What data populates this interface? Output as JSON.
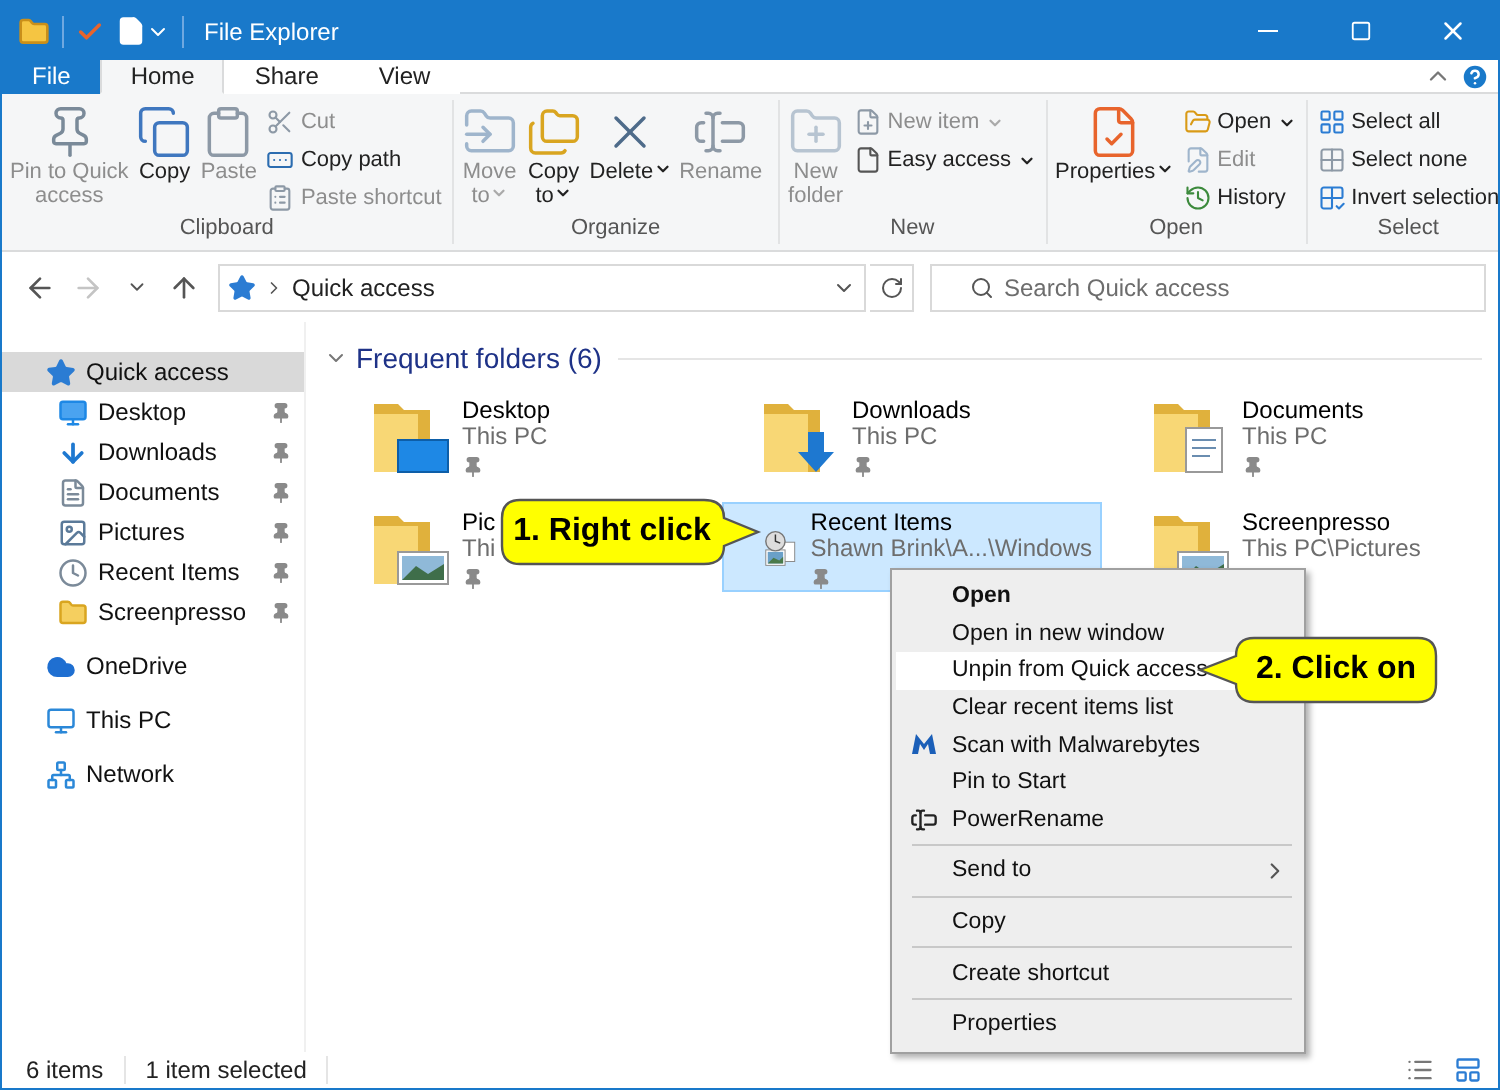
{
  "title_bar": {
    "title": "File Explorer"
  },
  "ribbon_tabs": [
    {
      "label": "File",
      "kind": "file",
      "selected": false
    },
    {
      "label": "Home",
      "kind": "tab",
      "selected": true
    },
    {
      "label": "Share",
      "kind": "tab",
      "selected": false
    },
    {
      "label": "View",
      "kind": "tab",
      "selected": false
    }
  ],
  "ribbon_groups": [
    {
      "label": "Clipboard",
      "buttons": [
        {
          "kind": "large",
          "label": "Pin to Quick\naccess",
          "disabled": true,
          "dropdown": false
        },
        {
          "kind": "large",
          "label": "Copy",
          "disabled": false,
          "dropdown": false
        },
        {
          "kind": "large",
          "label": "Paste",
          "disabled": true,
          "dropdown": false
        },
        {
          "kind": "small",
          "label": "Cut",
          "disabled": true,
          "dropdown": false
        },
        {
          "kind": "small",
          "label": "Copy path",
          "disabled": false,
          "dropdown": false
        },
        {
          "kind": "small",
          "label": "Paste shortcut",
          "disabled": true,
          "dropdown": false
        }
      ]
    },
    {
      "label": "Organize",
      "buttons": [
        {
          "kind": "large",
          "label": "Move\nto",
          "disabled": true,
          "dropdown": true
        },
        {
          "kind": "large",
          "label": "Copy\nto",
          "disabled": false,
          "dropdown": true
        },
        {
          "kind": "large",
          "label": "Delete",
          "disabled": false,
          "dropdown": true
        },
        {
          "kind": "large",
          "label": "Rename",
          "disabled": true,
          "dropdown": false
        }
      ]
    },
    {
      "label": "New",
      "buttons": [
        {
          "kind": "large",
          "label": "New\nfolder",
          "disabled": true,
          "dropdown": false
        },
        {
          "kind": "small",
          "label": "New item",
          "disabled": true,
          "dropdown": true
        },
        {
          "kind": "small",
          "label": "Easy access",
          "disabled": false,
          "dropdown": true
        }
      ]
    },
    {
      "label": "Open",
      "buttons": [
        {
          "kind": "large",
          "label": "Properties",
          "disabled": false,
          "dropdown": true
        },
        {
          "kind": "small",
          "label": "Open",
          "disabled": false,
          "dropdown": true
        },
        {
          "kind": "small",
          "label": "Edit",
          "disabled": true,
          "dropdown": false
        },
        {
          "kind": "small",
          "label": "History",
          "disabled": false,
          "dropdown": false
        }
      ]
    },
    {
      "label": "Select",
      "buttons": [
        {
          "kind": "small",
          "label": "Select all",
          "disabled": false,
          "dropdown": false
        },
        {
          "kind": "small",
          "label": "Select none",
          "disabled": false,
          "dropdown": false
        },
        {
          "kind": "small",
          "label": "Invert selection",
          "disabled": false,
          "dropdown": false
        }
      ]
    }
  ],
  "nav_buttons": [
    {
      "disabled": false
    },
    {
      "disabled": true
    },
    {
      "disabled": false
    },
    {
      "disabled": false
    }
  ],
  "address": {
    "location": "Quick access"
  },
  "search": {
    "placeholder": "Search Quick access"
  },
  "sidebar": {
    "items": [
      {
        "label": "Quick access",
        "selected": true,
        "children": [
          {
            "label": "Desktop",
            "pinned": true,
            "selected": false
          },
          {
            "label": "Downloads",
            "pinned": true,
            "selected": false
          },
          {
            "label": "Documents",
            "pinned": true,
            "selected": false
          },
          {
            "label": "Pictures",
            "pinned": true,
            "selected": false
          },
          {
            "label": "Recent Items",
            "pinned": true,
            "selected": false
          },
          {
            "label": "Screenpresso",
            "pinned": true,
            "selected": false
          }
        ]
      },
      {
        "label": "OneDrive",
        "selected": false
      },
      {
        "label": "This PC",
        "selected": false
      },
      {
        "label": "Network",
        "selected": false
      }
    ]
  },
  "section": {
    "title": "Frequent folders (6)",
    "expanded": true,
    "tiles": [
      {
        "name": "Desktop",
        "location": "This PC",
        "pinned": true,
        "selected": false
      },
      {
        "name": "Downloads",
        "location": "This PC",
        "pinned": true,
        "selected": false
      },
      {
        "name": "Documents",
        "location": "This PC",
        "pinned": true,
        "selected": false
      },
      {
        "name": "Pic",
        "location": "Thi",
        "pinned": true,
        "selected": false
      },
      {
        "name": "Recent Items",
        "location": "Shawn Brink\\A...\\Windows",
        "pinned": true,
        "selected": true
      },
      {
        "name": "Screenpresso",
        "location": "This PC\\Pictures",
        "selected": false
      }
    ]
  },
  "context_menu": {
    "groups": [
      [
        {
          "label": "Open",
          "default": true,
          "selected": false,
          "submenu": false
        },
        {
          "label": "Open in new window",
          "default": false,
          "selected": false,
          "submenu": false
        },
        {
          "label": "Unpin from Quick access",
          "default": false,
          "selected": true,
          "submenu": false
        },
        {
          "label": "Clear recent items list",
          "default": false,
          "selected": false,
          "submenu": false
        },
        {
          "label": "Scan with Malwarebytes",
          "default": false,
          "selected": false,
          "submenu": false
        },
        {
          "label": "Pin to Start",
          "default": false,
          "selected": false,
          "submenu": false
        },
        {
          "label": "PowerRename",
          "default": false,
          "selected": false,
          "submenu": false
        }
      ],
      [
        {
          "label": "Send to",
          "default": false,
          "selected": false,
          "submenu": true
        }
      ],
      [
        {
          "label": "Copy",
          "default": false,
          "selected": false,
          "submenu": false
        }
      ],
      [
        {
          "label": "Create shortcut",
          "default": false,
          "selected": false,
          "submenu": false
        }
      ],
      [
        {
          "label": "Properties",
          "default": false,
          "selected": false,
          "submenu": false
        }
      ]
    ]
  },
  "callouts": [
    {
      "text": "1. Right click"
    },
    {
      "text": "2. Click on"
    }
  ],
  "status_bar": {
    "count": "6 items",
    "selection": "1 item selected"
  }
}
